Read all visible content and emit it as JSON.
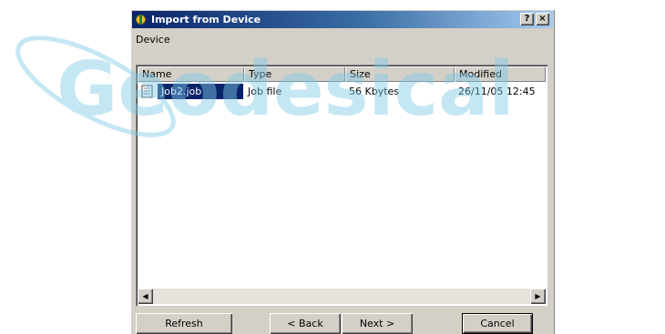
{
  "dialog": {
    "title": "Import from Device",
    "help_label": "?",
    "close_label": "×"
  },
  "device_label": "Device",
  "list": {
    "columns": [
      "Name",
      "Type",
      "Size",
      "Modified"
    ],
    "rows": [
      {
        "name": "Job2.job",
        "type": "Job file",
        "size": "56 Kbytes",
        "modified": "26/11/05 12:45"
      }
    ]
  },
  "scrollbar": {
    "left_arrow": "◀",
    "right_arrow": "▶"
  },
  "buttons": {
    "refresh": "Refresh",
    "back": "< Back",
    "next": "Next >",
    "cancel": "Cancel"
  },
  "watermark": {
    "text": "Geodesical",
    "color": "#7fcbe8"
  }
}
